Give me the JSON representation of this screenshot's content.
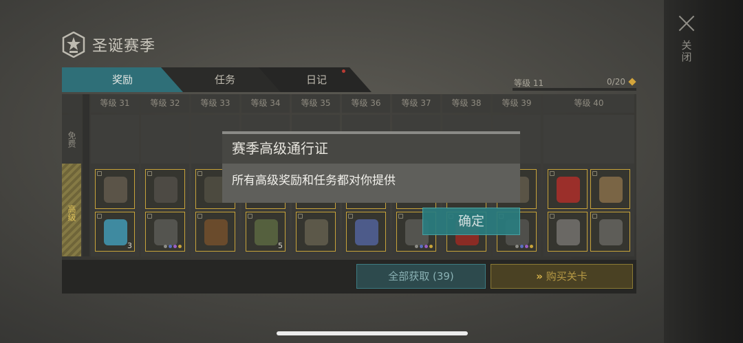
{
  "title": "圣诞赛季",
  "close_label": "关闭",
  "tabs": [
    {
      "label": "奖励",
      "active": true
    },
    {
      "label": "任务",
      "active": false
    },
    {
      "label": "日记",
      "active": false,
      "has_notification": true
    }
  ],
  "level": {
    "label": "等级 11",
    "progress_text": "0/20",
    "progress_fraction": 0.0
  },
  "rows": {
    "free_label": "免费",
    "advanced_label": "高级"
  },
  "columns": [
    {
      "label": "等级 31",
      "rewards": [
        {
          "icon": "boots-icon"
        },
        {
          "icon": "medkit-icon",
          "count": "3"
        }
      ]
    },
    {
      "label": "等级 32",
      "rewards": [
        {
          "icon": "pants-icon"
        },
        {
          "icon": "pistol-icon",
          "rarity": true
        }
      ]
    },
    {
      "label": "等级 33",
      "rewards": [
        {
          "icon": "vest-icon"
        },
        {
          "icon": "rifle-icon"
        }
      ]
    },
    {
      "label": "等级 34",
      "rewards": [
        {
          "icon": "helmet-icon"
        },
        {
          "icon": "grenade-icon",
          "count": "5"
        }
      ]
    },
    {
      "label": "等级 35",
      "rewards": [
        {
          "icon": "backpack-icon"
        },
        {
          "icon": "backpack-icon"
        }
      ]
    },
    {
      "label": "等级 36",
      "rewards": [
        {
          "icon": "gloves-icon"
        },
        {
          "icon": "battery-icon"
        }
      ]
    },
    {
      "label": "等级 37",
      "rewards": [
        {
          "icon": "jacket-icon"
        },
        {
          "icon": "crossbow-icon",
          "rarity": true
        }
      ]
    },
    {
      "label": "等级 38",
      "rewards": [
        {
          "icon": "mask-icon"
        },
        {
          "icon": "canister-icon"
        }
      ]
    },
    {
      "label": "等级 39",
      "rewards": [
        {
          "icon": "pack-icon"
        },
        {
          "icon": "smg-icon",
          "rarity": true
        }
      ]
    },
    {
      "label": "等级 40",
      "rewards": [
        {
          "icon": "book-icon"
        },
        {
          "icon": "hazmat-pack-icon"
        },
        {
          "icon": "engine-part-icon"
        },
        {
          "icon": "tool-icon"
        }
      ]
    }
  ],
  "buttons": {
    "claim_all": "全部获取 (39)",
    "buy_levels": "购买关卡",
    "confirm": "确定"
  },
  "dialog": {
    "title": "赛季高级通行证",
    "message": "所有高级奖励和任务都对你提供"
  },
  "colors": {
    "accent_teal": "#2f6f78",
    "gold": "#c9a43a",
    "panel_dark": "#262624"
  }
}
